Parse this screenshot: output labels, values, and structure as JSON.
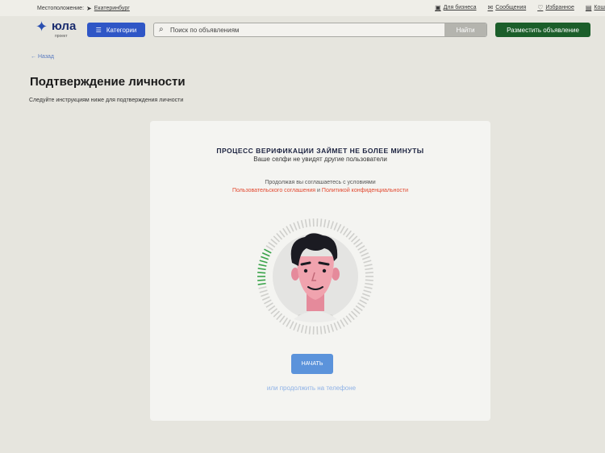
{
  "topbar": {
    "location_label": "Местоположение:",
    "city": "Екатеринбург",
    "links": [
      {
        "label": "Для бизнеса",
        "icon": "briefcase-icon"
      },
      {
        "label": "Сообщения",
        "icon": "envelope-icon"
      },
      {
        "label": "Избранное",
        "icon": "heart-icon"
      },
      {
        "label": "Кош",
        "icon": "wallet-icon"
      }
    ]
  },
  "header": {
    "logo_text": "юла",
    "logo_sub": "проект",
    "categories_label": "Категории",
    "search_placeholder": "Поиск по объявлениям",
    "search_button": "Найти",
    "post_button": "Разместить объявление"
  },
  "page": {
    "back_label": "← Назад",
    "title": "Подтверждение личности",
    "subtitle": "Следуйте инструкциям ниже для подтверждения личности"
  },
  "card": {
    "title": "ПРОЦЕСС ВЕРИФИКАЦИИ ЗАЙМЕТ НЕ БОЛЕЕ МИНУТЫ",
    "subtitle": "Ваше селфи не увидят другие пользователи",
    "terms_prefix": "Продолжая вы соглашаетесь с условиями",
    "terms_link1": "Пользовательского соглашения",
    "terms_and": " и ",
    "terms_link2": "Политикой конфиденциальности",
    "start_button": "НАЧАТЬ",
    "phone_link": "или продолжить на телефоне"
  },
  "colors": {
    "brand_blue": "#2f56c6",
    "post_green": "#1b5e2a",
    "terms_red": "#e2482f",
    "progress_green": "#3aa34a",
    "start_button": "#5b93db"
  }
}
